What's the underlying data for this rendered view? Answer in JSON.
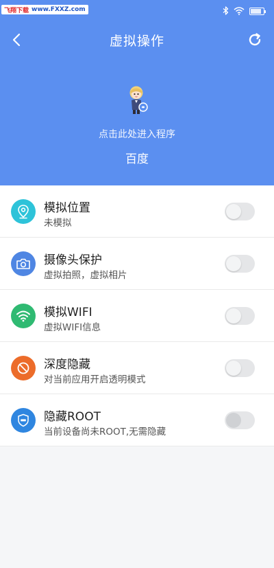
{
  "status_bar": {
    "watermark_brand": "飞翔下载",
    "watermark_url": "www.FXXZ.com",
    "battery_level": 0.85
  },
  "header": {
    "title": "虚拟操作",
    "back_icon": "back-arrow-icon",
    "refresh_icon": "refresh-icon",
    "enter_hint": "点击此处进入程序",
    "app_name": "百度",
    "background_color": "#5b8ff0"
  },
  "features": [
    {
      "title": "模拟位置",
      "subtitle": "未模拟",
      "icon": "location-pin-icon",
      "icon_color": "#2ec3d9",
      "enabled": false
    },
    {
      "title": "摄像头保护",
      "subtitle": "虚拟拍照，虚拟相片",
      "icon": "camera-icon",
      "icon_color": "#4f86e3",
      "enabled": false
    },
    {
      "title": "模拟WIFI",
      "subtitle": "虚拟WIFI信息",
      "icon": "wifi-icon",
      "icon_color": "#2fba72",
      "enabled": false
    },
    {
      "title": "深度隐藏",
      "subtitle": "对当前应用开启透明模式",
      "icon": "prohibit-icon",
      "icon_color": "#ec6c2a",
      "enabled": false
    },
    {
      "title": "隐藏ROOT",
      "subtitle": "当前设备尚未ROOT,无需隐藏",
      "icon": "root-shield-icon",
      "icon_color": "#2f86e0",
      "enabled": false
    }
  ]
}
